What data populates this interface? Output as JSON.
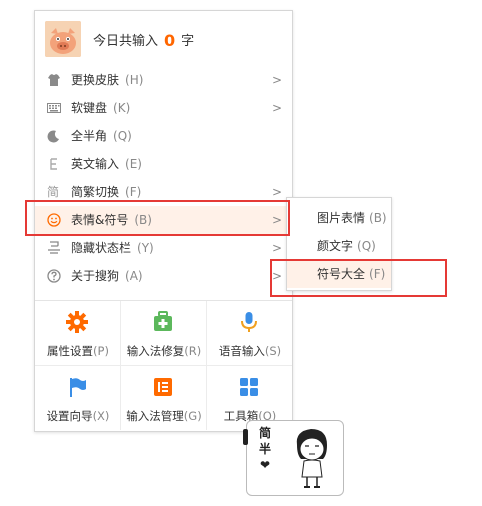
{
  "header": {
    "prefix": "今日共输入",
    "count": "0",
    "suffix": "字"
  },
  "menu_items": [
    {
      "label": "更换皮肤",
      "shortcut": "(H)",
      "icon": "shirt-icon",
      "has_submenu": true
    },
    {
      "label": "软键盘",
      "shortcut": "(K)",
      "icon": "keyboard-icon",
      "has_submenu": true
    },
    {
      "label": "全半角",
      "shortcut": "(Q)",
      "icon": "moon-icon",
      "has_submenu": false
    },
    {
      "label": "英文输入",
      "shortcut": "(E)",
      "icon": "letter-e-icon",
      "has_submenu": false
    },
    {
      "label": "简繁切换",
      "shortcut": "(F)",
      "icon": "jian-char-icon",
      "has_submenu": true
    },
    {
      "label": "表情&符号",
      "shortcut": "(B)",
      "icon": "smiley-icon",
      "has_submenu": true,
      "active": true
    },
    {
      "label": "隐藏状态栏",
      "shortcut": "(Y)",
      "icon": "hide-statusbar-icon",
      "has_submenu": true
    },
    {
      "label": "关于搜狗",
      "shortcut": "(A)",
      "icon": "question-icon",
      "has_submenu": true
    }
  ],
  "tools": [
    {
      "label": "属性设置",
      "shortcut": "(P)",
      "icon": "settings-gear-icon",
      "color": "#ff6a00"
    },
    {
      "label": "输入法修复",
      "shortcut": "(R)",
      "icon": "repair-kit-icon",
      "color": "#5cb85c"
    },
    {
      "label": "语音输入",
      "shortcut": "(S)",
      "icon": "microphone-icon",
      "color": "#3a8ee6"
    },
    {
      "label": "设置向导",
      "shortcut": "(X)",
      "icon": "flag-icon",
      "color": "#3a8ee6"
    },
    {
      "label": "输入法管理",
      "shortcut": "(G)",
      "icon": "manage-list-icon",
      "color": "#ff6a00"
    },
    {
      "label": "工具箱",
      "shortcut": "(O)",
      "icon": "toolbox-grid-icon",
      "color": "#3a8ee6"
    }
  ],
  "submenu": [
    {
      "label": "图片表情",
      "shortcut": "(B)"
    },
    {
      "label": "颜文字",
      "shortcut": "(Q)"
    },
    {
      "label": "符号大全",
      "shortcut": "(F)",
      "active": true
    }
  ],
  "status_bar": {
    "line1": "简",
    "line2": "半",
    "line3": "❤"
  },
  "colors": {
    "accent": "#ff6600",
    "highlight_box": "#e53935",
    "active_row": "#fff1e8"
  }
}
